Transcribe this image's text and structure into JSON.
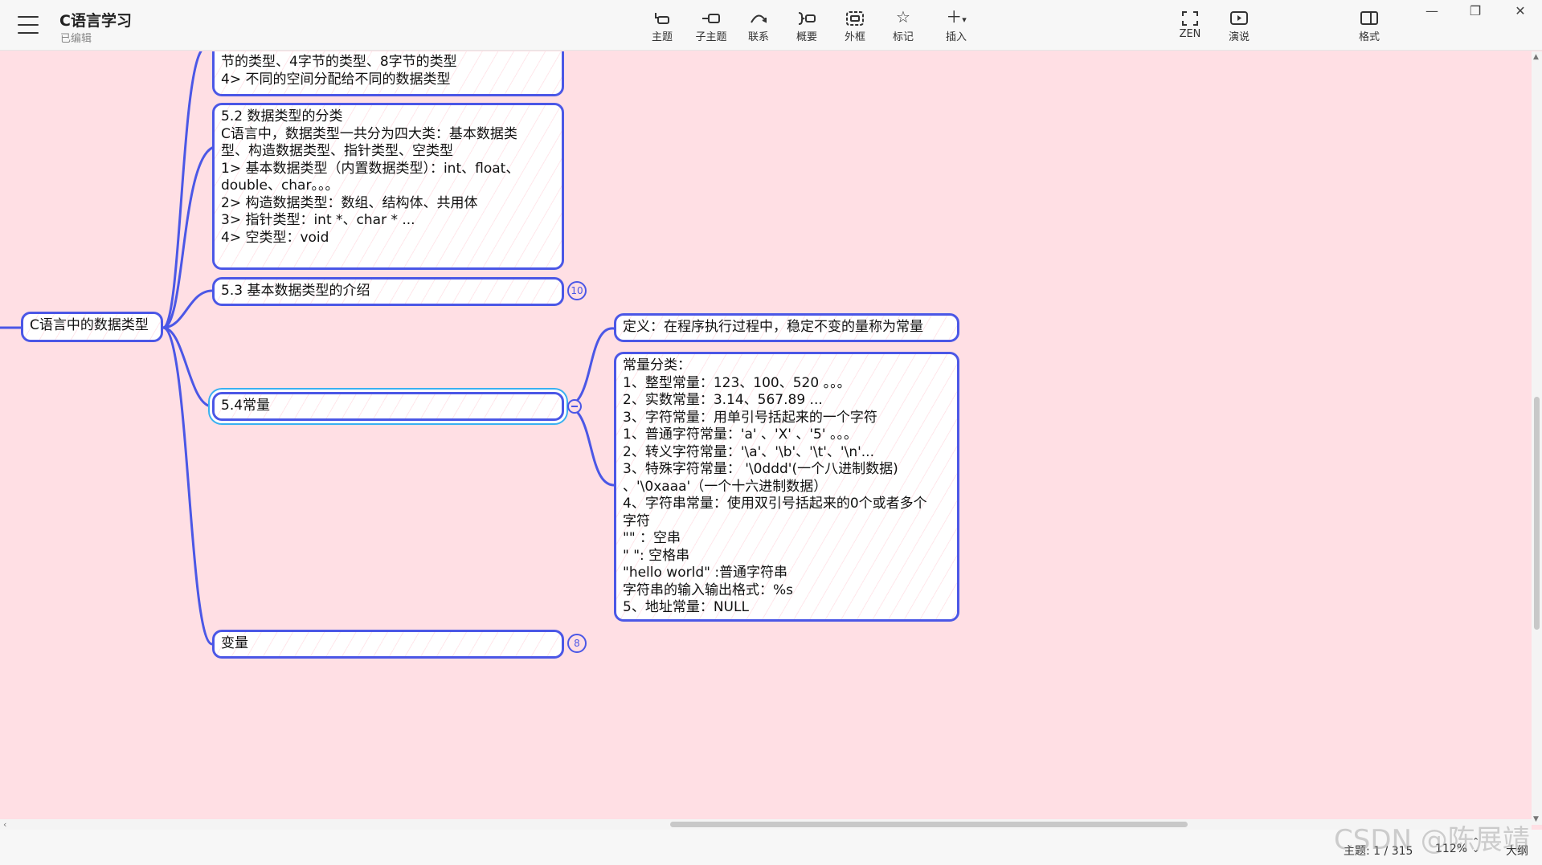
{
  "app": {
    "title": "C语言学习",
    "status": "已编辑"
  },
  "toolbar": {
    "tools": [
      {
        "label": "主题",
        "icon": "topic-icon"
      },
      {
        "label": "子主题",
        "icon": "subtopic-icon"
      },
      {
        "label": "联系",
        "icon": "relationship-icon"
      },
      {
        "label": "概要",
        "icon": "summary-icon"
      },
      {
        "label": "外框",
        "icon": "boundary-icon"
      },
      {
        "label": "标记",
        "icon": "star-icon"
      },
      {
        "label": "插入",
        "icon": "plus-icon"
      },
      {
        "label": "ZEN",
        "icon": "fullscreen-icon"
      },
      {
        "label": "演说",
        "icon": "play-icon"
      },
      {
        "label": "格式",
        "icon": "panel-icon"
      }
    ]
  },
  "map": {
    "root": "C语言中的数据类型",
    "top_partial": {
      "lines": [
        "节的类型、4字节的类型、8字节的类型",
        "4>   不同的空间分配给不同的数据类型"
      ]
    },
    "sec52": {
      "lines": [
        "5.2   数据类型的分类",
        "C语言中，数据类型一共分为四大类：基本数据类",
        "型、构造数据类型、指针类型、空类型",
        "1>   基本数据类型（内置数据类型）：int、float、",
        "double、char。。。",
        "2>   构造数据类型：数组、结构体、共用体",
        "3>   指针类型：int *、char * ...",
        "4>   空类型：void"
      ]
    },
    "sec53": {
      "label": "5.3 基本数据类型的介绍",
      "badge": "10"
    },
    "sec54": {
      "label": "5.4常量"
    },
    "variables": {
      "label": "变量",
      "badge": "8"
    },
    "definition": {
      "label": "定义：在程序执行过程中，稳定不变的量称为常量"
    },
    "classification": {
      "lines": [
        " 常量分类：",
        "1、整型常量：123、100、520 。。。",
        "2、实数常量：3.14、567.89 ...",
        "3、字符常量：用单引号括起来的一个字符",
        "1、普通字符常量：'a' 、'X' 、'5' 。。。",
        "2、转义字符常量：'\\a'、'\\b'、'\\t'、'\\n'...",
        "3、特殊字符常量： '\\0ddd'(一个八进制数据)",
        "、'\\0xaaa'（一个十六进制数据）",
        " 4、字符串常量：使用双引号括起来的0个或者多个",
        "字符",
        "\"\" ：空串",
        "\"    \": 空格串",
        "\"hello world\" :普通字符串",
        "字符串的输入输出格式：%s",
        "5、地址常量：NULL"
      ]
    }
  },
  "statusbar": {
    "topics": "主题: 1 / 315",
    "zoom": "112%",
    "size": "大纲"
  },
  "watermark": "CSDN @陈展靖",
  "colors": {
    "canvas_bg": "#ffdfe4",
    "node_border": "#4b57e6",
    "selection": "#3ab0f0"
  }
}
